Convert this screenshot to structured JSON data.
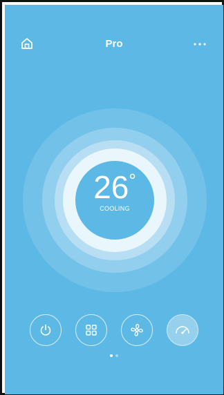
{
  "header": {
    "title": "Pro",
    "home_icon": "home-icon",
    "more_icon": "more-horizontal-icon"
  },
  "thermostat": {
    "temperature": "26",
    "unit": "°",
    "mode": "COOLING"
  },
  "controls": [
    {
      "name": "power-button",
      "icon": "power-icon",
      "active": false
    },
    {
      "name": "mode-button",
      "icon": "grid-icon",
      "active": false
    },
    {
      "name": "fan-button",
      "icon": "fan-icon",
      "active": false
    },
    {
      "name": "eco-button",
      "icon": "eco-gauge-icon",
      "active": true
    }
  ],
  "pager": {
    "pages": 2,
    "current": 1
  },
  "colors": {
    "background": "#5cb8e4",
    "ring_outer": "#71c1e8",
    "ring_inner": "#e9f6fc",
    "text": "#ffffff"
  }
}
